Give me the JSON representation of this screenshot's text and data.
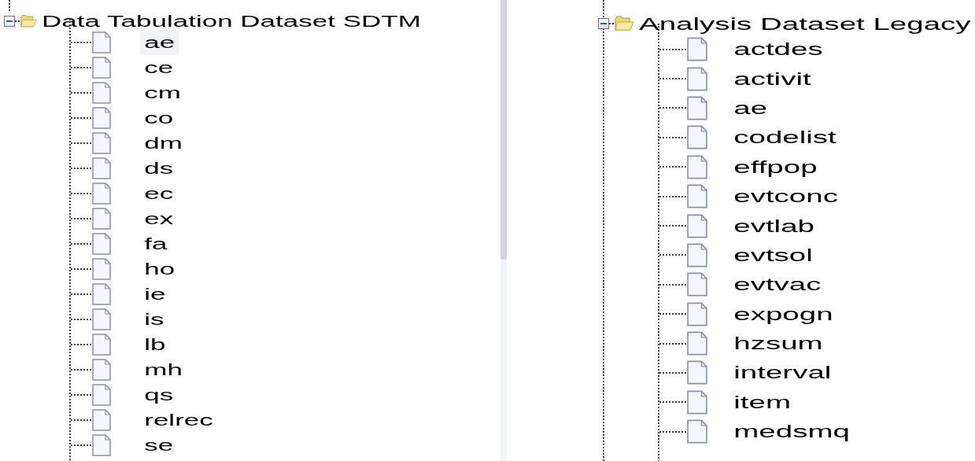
{
  "trees": [
    {
      "root": {
        "label": "Data Tabulation Dataset SDTM",
        "expanded": true
      },
      "children": [
        {
          "label": "ae",
          "selected": true
        },
        {
          "label": "ce",
          "selected": false
        },
        {
          "label": "cm",
          "selected": false
        },
        {
          "label": "co",
          "selected": false
        },
        {
          "label": "dm",
          "selected": false
        },
        {
          "label": "ds",
          "selected": false
        },
        {
          "label": "ec",
          "selected": false
        },
        {
          "label": "ex",
          "selected": false
        },
        {
          "label": "fa",
          "selected": false
        },
        {
          "label": "ho",
          "selected": false
        },
        {
          "label": "ie",
          "selected": false
        },
        {
          "label": "is",
          "selected": false
        },
        {
          "label": "lb",
          "selected": false
        },
        {
          "label": "mh",
          "selected": false
        },
        {
          "label": "qs",
          "selected": false
        },
        {
          "label": "relrec",
          "selected": false
        },
        {
          "label": "se",
          "selected": false
        }
      ]
    },
    {
      "root": {
        "label": "Analysis Dataset Legacy",
        "expanded": true
      },
      "children": [
        {
          "label": "actdes",
          "selected": false
        },
        {
          "label": "activit",
          "selected": false
        },
        {
          "label": "ae",
          "selected": false
        },
        {
          "label": "codelist",
          "selected": false
        },
        {
          "label": "effpop",
          "selected": false
        },
        {
          "label": "evtconc",
          "selected": false
        },
        {
          "label": "evtlab",
          "selected": false
        },
        {
          "label": "evtsol",
          "selected": false
        },
        {
          "label": "evtvac",
          "selected": false
        },
        {
          "label": "expogn",
          "selected": false
        },
        {
          "label": "hzsum",
          "selected": false
        },
        {
          "label": "interval",
          "selected": false
        },
        {
          "label": "item",
          "selected": false
        },
        {
          "label": "medsmq",
          "selected": false
        }
      ]
    }
  ]
}
